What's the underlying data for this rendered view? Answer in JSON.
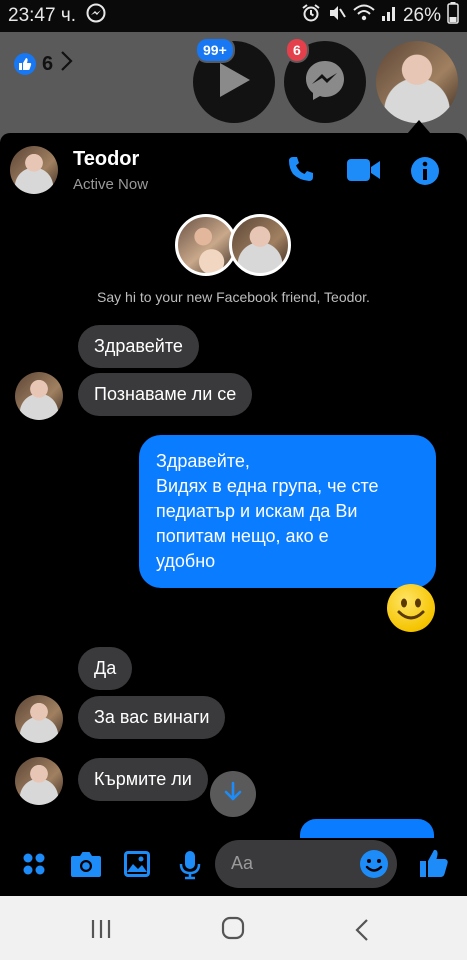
{
  "status": {
    "time": "23:47",
    "time_suffix": "ч.",
    "battery": "26%"
  },
  "background": {
    "like_count": "6"
  },
  "chatheads": {
    "video_badge": "99+",
    "messenger_badge": "6"
  },
  "header": {
    "name": "Teodor",
    "status": "Active Now"
  },
  "intro": {
    "text": "Say hi to your new Facebook friend, Teodor."
  },
  "messages": [
    {
      "from": "them",
      "text": "Здравейте"
    },
    {
      "from": "them",
      "text": "Познаваме ли се"
    },
    {
      "from": "me",
      "lines": [
        "Здравейте,",
        "Видях в една група, че сте",
        "педиатър и искам да Ви",
        "попитам нещо, ако е",
        "удобно"
      ]
    },
    {
      "from": "me",
      "emoji": "smile"
    },
    {
      "from": "them",
      "text": "Да"
    },
    {
      "from": "them",
      "text": "За вас винаги"
    },
    {
      "from": "them",
      "text": "Кърмите ли"
    }
  ],
  "composer": {
    "placeholder": "Aa"
  },
  "colors": {
    "accent": "#0a7cff",
    "icon_blue": "#1d8cf8",
    "incoming_bubble": "#3a3a3c",
    "badge_red": "#e4404b"
  },
  "icons": [
    "messenger-icon",
    "alarm-icon",
    "mute-icon",
    "wifi-icon",
    "signal-icon",
    "phone-icon",
    "video-call-icon",
    "info-icon",
    "menu-dots-icon",
    "camera-icon",
    "gallery-icon",
    "microphone-icon",
    "emoji-icon",
    "like-thumb-icon",
    "recent-apps-icon",
    "home-icon",
    "back-icon"
  ]
}
